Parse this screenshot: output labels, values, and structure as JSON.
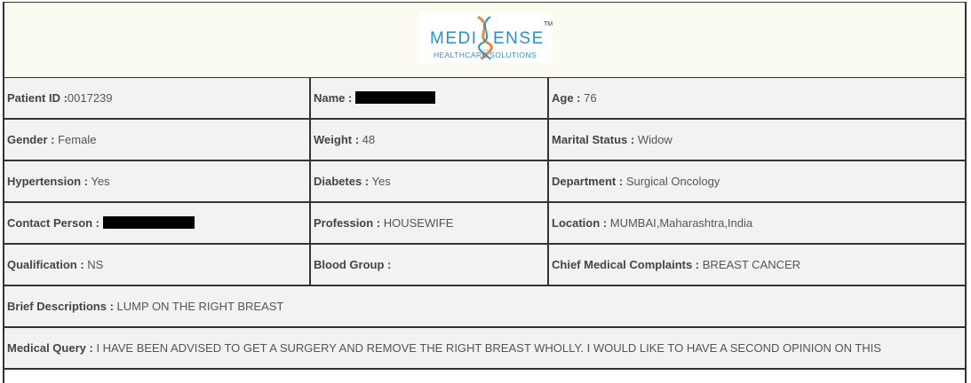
{
  "logo": {
    "brand_left": "MEDI",
    "brand_right": "ENSE",
    "tagline": "HEALTHCARE SOLUTIONS",
    "trademark": "TM",
    "colors": {
      "text": "#2f8fc4",
      "dna_orange": "#e8893a",
      "dna_blue": "#2f8fc4"
    }
  },
  "fields": {
    "patient_id": {
      "label": "Patient ID :",
      "value": "0017239"
    },
    "name": {
      "label": "Name :",
      "value": ""
    },
    "age": {
      "label": "Age :",
      "value": "76"
    },
    "gender": {
      "label": "Gender :",
      "value": "Female"
    },
    "weight": {
      "label": "Weight :",
      "value": "48"
    },
    "marital_status": {
      "label": "Marital Status :",
      "value": "Widow"
    },
    "hypertension": {
      "label": "Hypertension :",
      "value": "Yes"
    },
    "diabetes": {
      "label": "Diabetes :",
      "value": "Yes"
    },
    "department": {
      "label": "Department :",
      "value": "Surgical Oncology"
    },
    "contact_person": {
      "label": "Contact Person :",
      "value": ""
    },
    "profession": {
      "label": "Profession :",
      "value": "HOUSEWIFE"
    },
    "location": {
      "label": "Location :",
      "value": "MUMBAI,Maharashtra,India"
    },
    "qualification": {
      "label": "Qualification :",
      "value": "NS"
    },
    "blood_group": {
      "label": "Blood Group :",
      "value": ""
    },
    "chief_complaints": {
      "label": "Chief Medical Complaints :",
      "value": "BREAST CANCER"
    },
    "brief_descriptions": {
      "label": "Brief Descriptions :",
      "value": "LUMP ON THE RIGHT BREAST"
    },
    "medical_query": {
      "label": "Medical Query :",
      "value": "I HAVE BEEN ADVISED TO GET A SURGERY AND REMOVE THE RIGHT BREAST WHOLLY. I WOULD LIKE TO HAVE A SECOND OPINION ON THIS"
    }
  }
}
